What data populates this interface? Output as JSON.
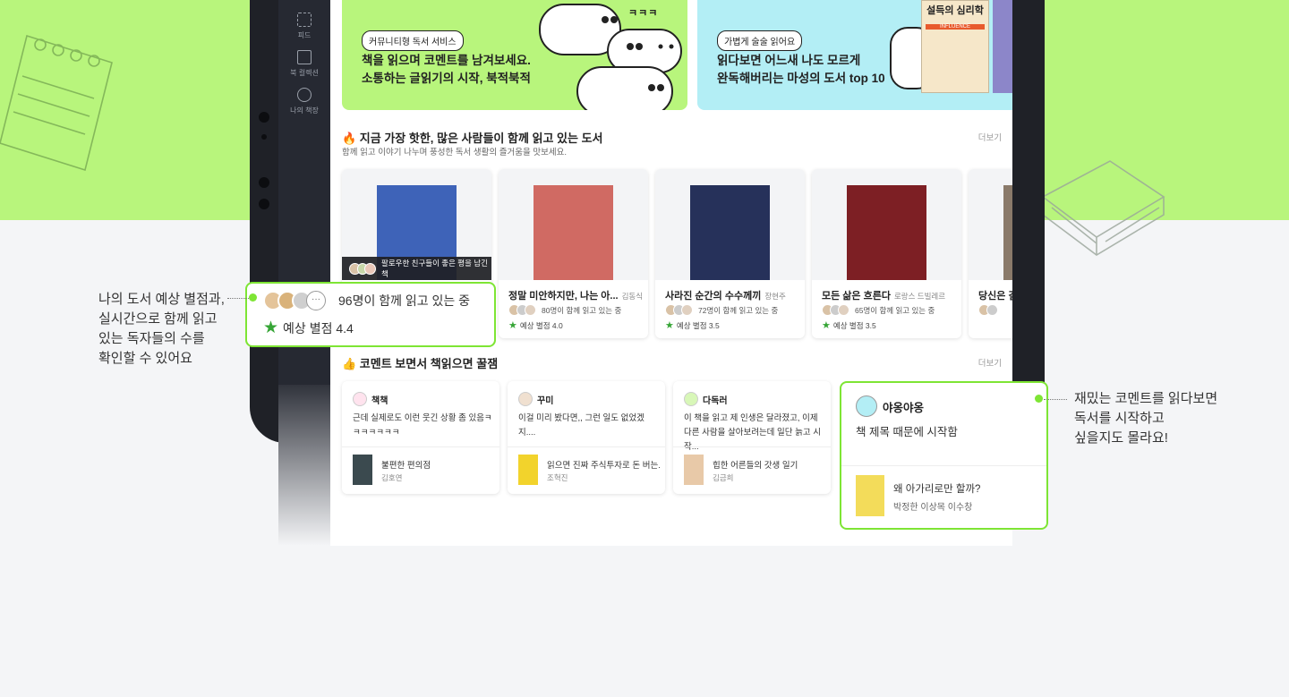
{
  "rail": [
    {
      "label": "피드",
      "icon": "grid-icon"
    },
    {
      "label": "북 컬렉션",
      "icon": "collection-icon"
    },
    {
      "label": "나의 책장",
      "icon": "smile-icon"
    }
  ],
  "banners": [
    {
      "chip": "커뮤니티형 독서 서비스",
      "line1": "책을 읽으며 코멘트를 남겨보세요.",
      "line2": "소통하는 글읽기의 시작, 북적북적",
      "bubble_text": "ㅋㅋㅋ",
      "color": "#b8f57c"
    },
    {
      "chip": "가볍게 술술 읽어요",
      "line1": "읽다보면 어느새 나도 모르게",
      "line2": "완독해버리는 마성의 도서 top 10",
      "cover_title": "설득의 심리학",
      "cover_sub": "INFLUENCE",
      "color": "#b3eef5"
    }
  ],
  "hot_section": {
    "title": "🔥 지금 가장 핫한, 많은 사람들이 함께 읽고 있는 도서",
    "subtitle": "함께 읽고 이야기 나누며 풍성한 독서 생활의 즐거움을 맛보세요.",
    "more": "더보기"
  },
  "books": [
    {
      "title": "",
      "author": "",
      "readers": "",
      "rating": "",
      "friend_strip": "팔로우한 친구들이 좋은 평을 남긴책",
      "cover_color": "#3e63b8"
    },
    {
      "title": "정말 미안하지만, 나는 아...",
      "author": "김동식",
      "readers": "80명이 함께 읽고 있는 중",
      "rating": "예상 별점 4.0",
      "cover_color": "#d06a63"
    },
    {
      "title": "사라진 순간의 수수께끼",
      "author": "장현주",
      "readers": "72명이 함께 읽고 있는 중",
      "rating": "예상 별점 3.5",
      "cover_color": "#26315a"
    },
    {
      "title": "모든 삶은 흐른다",
      "author": "로랑스 드빌레르",
      "readers": "65명이 함께 읽고 있는 중",
      "rating": "예상 별점 3.5",
      "cover_color": "#7d1f24"
    },
    {
      "title": "당신은 길",
      "author": "",
      "readers": "",
      "rating": "",
      "cover_color": "#8a7a6a"
    }
  ],
  "comment_section": {
    "title": "👍 코멘트 보면서 책읽으면 꿀잼",
    "more": "더보기"
  },
  "comments": [
    {
      "user": "책책",
      "text": "근데 실제로도 이런 웃긴 상황 좀 있음ㅋㅋㅋㅋㅋㅋㅋ",
      "book_title": "불편한 편의점",
      "book_author": "김호연",
      "avatar_color": "#ffe3ee",
      "thumb_color": "#3b4a4f"
    },
    {
      "user": "꾸미",
      "text": "이걸 미리 봤다면,, 그런 일도 없었겠지....",
      "book_title": "읽으면 진짜 주식투자로 돈 버는...",
      "book_author": "조혁진",
      "avatar_color": "#f0e0d0",
      "thumb_color": "#f2d32c"
    },
    {
      "user": "다독러",
      "text": "이 책을 읽고 제 인생은 달라졌고, 이제 다른 사람을 살아보려는데 일단 늙고 시작...",
      "book_title": "힙한 어른들의 갓생 일기",
      "book_author": "김금희",
      "avatar_color": "#d8f7b8",
      "thumb_color": "#e8c9a8"
    }
  ],
  "highlight_rating": {
    "readers": "96명이 함께 읽고 있는 중",
    "rating": "예상 별점 4.4",
    "more_avatars": "···"
  },
  "highlight_comment": {
    "user": "야옹야옹",
    "text": "책 제목 때문에 시작함",
    "book_title": "왜 아가리로만 할까?",
    "book_author": "박정한 이상목 이수창"
  },
  "annotations": {
    "left": [
      "나의 도서 예상 별점과,",
      "실시간으로 함께 읽고",
      "있는 독자들의 수를",
      "확인할 수 있어요"
    ],
    "right": [
      "재밌는 코멘트를 읽다보면",
      "독서를 시작하고",
      "싶을지도 몰라요!"
    ]
  },
  "colors": {
    "accent_green": "#7ee534",
    "band_green": "#b8f57c",
    "star_green": "#36a536"
  }
}
